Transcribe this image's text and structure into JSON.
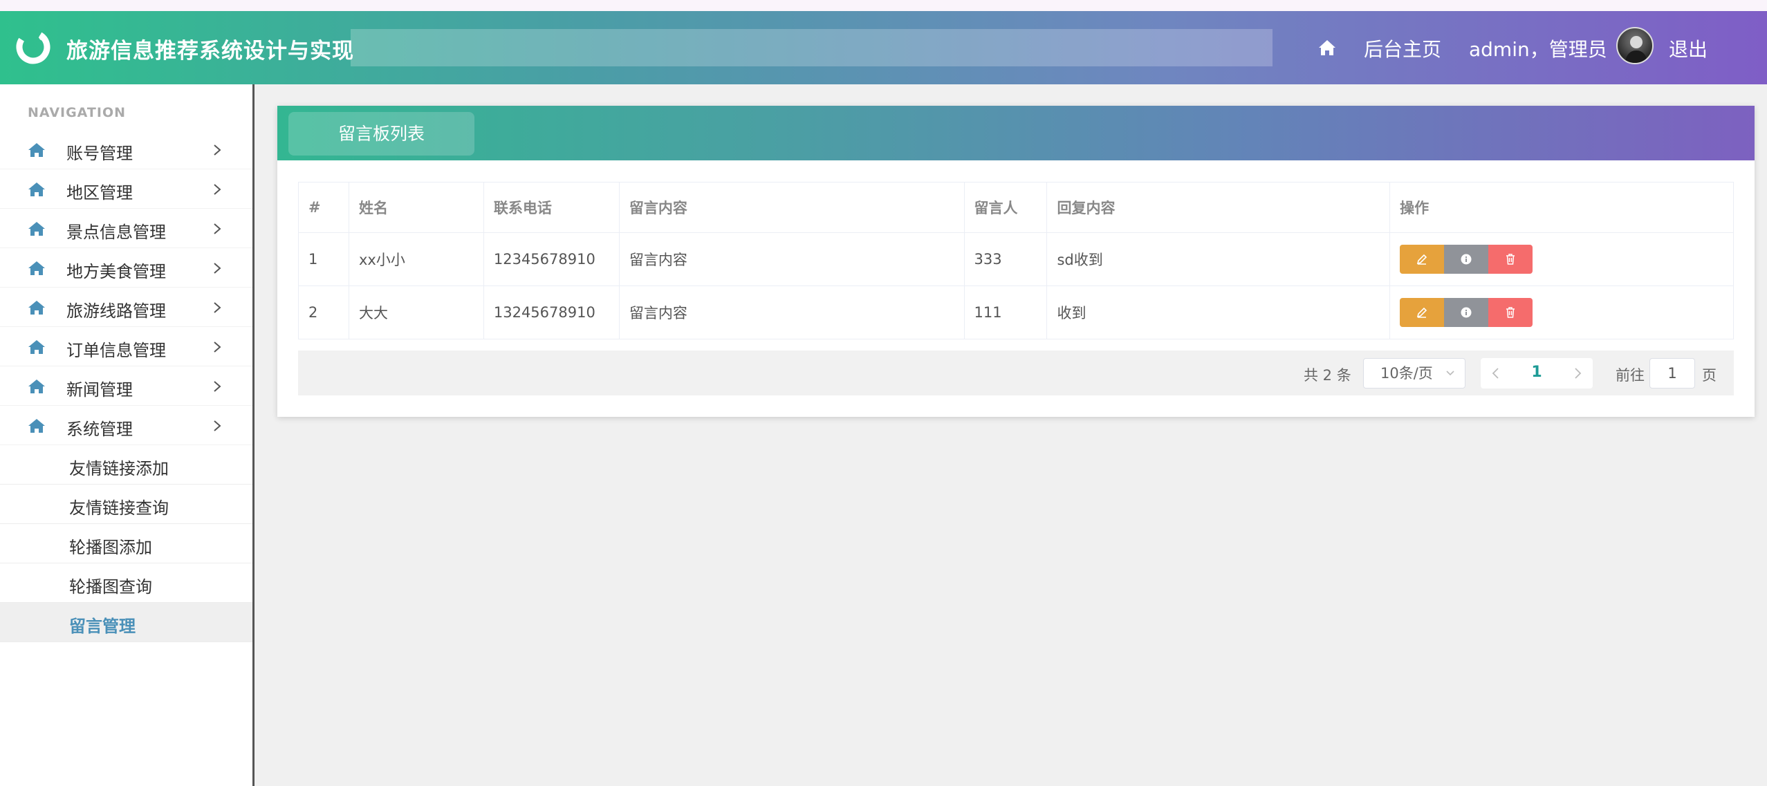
{
  "header": {
    "title": "旅游信息推荐系统设计与实现",
    "home_icon": "home-icon",
    "home_link": "后台主页",
    "user": "admin，管理员",
    "logout": "退出"
  },
  "sidebar": {
    "heading": "NAVIGATION",
    "items": [
      {
        "label": "账号管理"
      },
      {
        "label": "地区管理"
      },
      {
        "label": "景点信息管理"
      },
      {
        "label": "地方美食管理"
      },
      {
        "label": "旅游线路管理"
      },
      {
        "label": "订单信息管理"
      },
      {
        "label": "新闻管理"
      },
      {
        "label": "系统管理"
      }
    ],
    "subitems": [
      {
        "label": "友情链接添加"
      },
      {
        "label": "友情链接查询"
      },
      {
        "label": "轮播图添加"
      },
      {
        "label": "轮播图查询"
      },
      {
        "label": "留言管理"
      }
    ],
    "active_subitem": "留言管理"
  },
  "panel": {
    "tab": "留言板列表",
    "columns": [
      "#",
      "姓名",
      "联系电话",
      "留言内容",
      "留言人",
      "回复内容",
      "操作"
    ],
    "rows": [
      {
        "idx": "1",
        "name": "xx小小",
        "phone": "12345678910",
        "content": "留言内容",
        "author": "333",
        "reply": "sd收到"
      },
      {
        "idx": "2",
        "name": "大大",
        "phone": "13245678910",
        "content": "留言内容",
        "author": "111",
        "reply": "收到"
      }
    ],
    "colors": {
      "edit": "#e6a23c",
      "info": "#909399",
      "delete": "#f56c6c"
    }
  },
  "pagination": {
    "total": "共 2 条",
    "page_size": "10条/页",
    "current_page": "1",
    "goto_label": "前往",
    "goto_value": "1",
    "goto_suffix": "页"
  }
}
